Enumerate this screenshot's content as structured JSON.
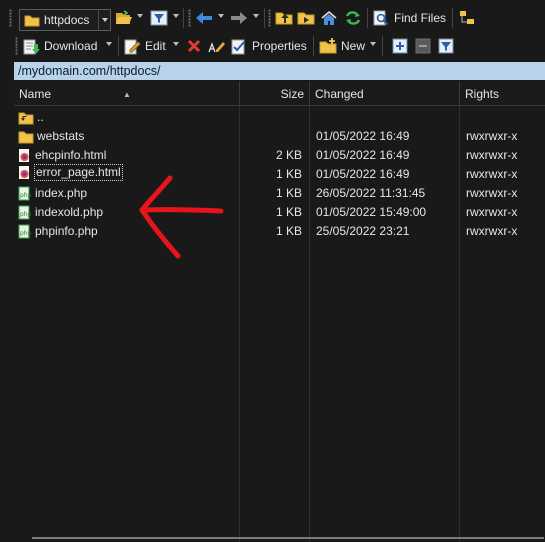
{
  "toolbar1": {
    "location_combo_value": "httpdocs",
    "find_files_label": "Find Files"
  },
  "toolbar2": {
    "download_label": "Download",
    "edit_label": "Edit",
    "properties_label": "Properties",
    "new_label": "New"
  },
  "path": "/mydomain.com/httpdocs/",
  "columns": {
    "name": "Name",
    "size": "Size",
    "changed": "Changed",
    "rights": "Rights"
  },
  "files": [
    {
      "name": "..",
      "size": "",
      "changed": "",
      "rights": "",
      "icon": "parent-folder-icon"
    },
    {
      "name": "webstats",
      "size": "",
      "changed": "01/05/2022 16:49",
      "rights": "rwxrwxr-x",
      "icon": "folder-icon"
    },
    {
      "name": "ehcpinfo.html",
      "size": "2 KB",
      "changed": "01/05/2022 16:49",
      "rights": "rwxrwxr-x",
      "icon": "html-file-icon"
    },
    {
      "name": "error_page.html",
      "size": "1 KB",
      "changed": "01/05/2022 16:49",
      "rights": "rwxrwxr-x",
      "icon": "html-file-icon"
    },
    {
      "name": "index.php",
      "size": "1 KB",
      "changed": "26/05/2022 11:31:45",
      "rights": "rwxrwxr-x",
      "icon": "php-file-icon"
    },
    {
      "name": "indexold.php",
      "size": "1 KB",
      "changed": "01/05/2022 15:49:00",
      "rights": "rwxrwxr-x",
      "icon": "php-file-icon"
    },
    {
      "name": "phpinfo.php",
      "size": "1 KB",
      "changed": "25/05/2022 23:21",
      "rights": "rwxrwxr-x",
      "icon": "php-file-icon"
    }
  ],
  "colors": {
    "path_bar": "#b8d2ea",
    "annotation_arrow": "#e8141c",
    "folder": "#f2c34a",
    "php_icon": "#3f9f4a"
  }
}
